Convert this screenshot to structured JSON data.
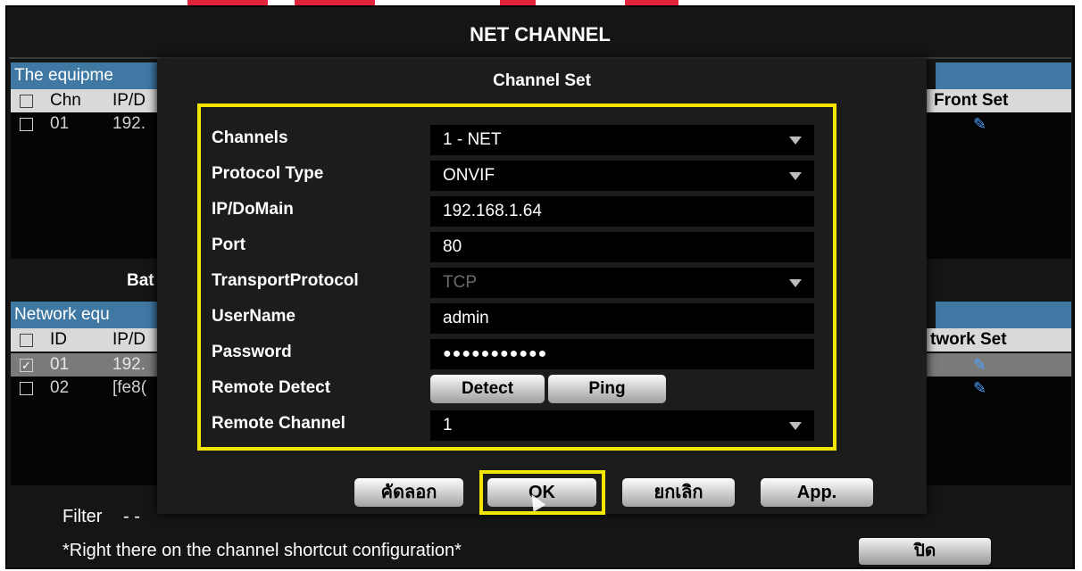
{
  "window": {
    "title": "NET CHANNEL"
  },
  "equipment_section": {
    "header": "The equipme",
    "columns": {
      "chn": "Chn",
      "ip": "IP/D",
      "front_set": "Front Set"
    },
    "rows": [
      {
        "chn": "01",
        "ip": "192."
      }
    ]
  },
  "batch_button": "Bat",
  "network_section": {
    "header": "Network equ",
    "columns": {
      "id": "ID",
      "ip": "IP/D",
      "network_set": "twork Set"
    },
    "rows": [
      {
        "id": "01",
        "ip": "192.",
        "checked": true
      },
      {
        "id": "02",
        "ip": "[fe8(",
        "checked": false
      }
    ]
  },
  "filter": {
    "label": "Filter",
    "value": "- -"
  },
  "footer_note": "*Right there on the channel shortcut configuration*",
  "close_button": "ปิด",
  "dialog": {
    "title": "Channel Set",
    "fields": {
      "channels": {
        "label": "Channels",
        "value": "1 - NET"
      },
      "protocol_type": {
        "label": "Protocol Type",
        "value": "ONVIF"
      },
      "ip_domain": {
        "label": "IP/DoMain",
        "value": "192.168.1.64"
      },
      "port": {
        "label": "Port",
        "value": "80"
      },
      "transport_protocol": {
        "label": "TransportProtocol",
        "value": "TCP"
      },
      "username": {
        "label": "UserName",
        "value": "admin"
      },
      "password": {
        "label": "Password",
        "value": "●●●●●●●●●●●"
      },
      "remote_detect": {
        "label": "Remote Detect",
        "detect_button": "Detect",
        "ping_button": "Ping"
      },
      "remote_channel": {
        "label": "Remote Channel",
        "value": "1"
      }
    },
    "buttons": {
      "copy": "คัดลอก",
      "ok": "OK",
      "cancel": "ยกเลิก",
      "apply": "App."
    }
  },
  "colors": {
    "header_blue": "#3f78a3",
    "highlight_yellow": "#f2e600",
    "link_blue": "#4aa3ff"
  },
  "icons": {
    "dropdown": "triangle-down",
    "edit": "pencil-icon",
    "cursor": "mouse-pointer"
  }
}
